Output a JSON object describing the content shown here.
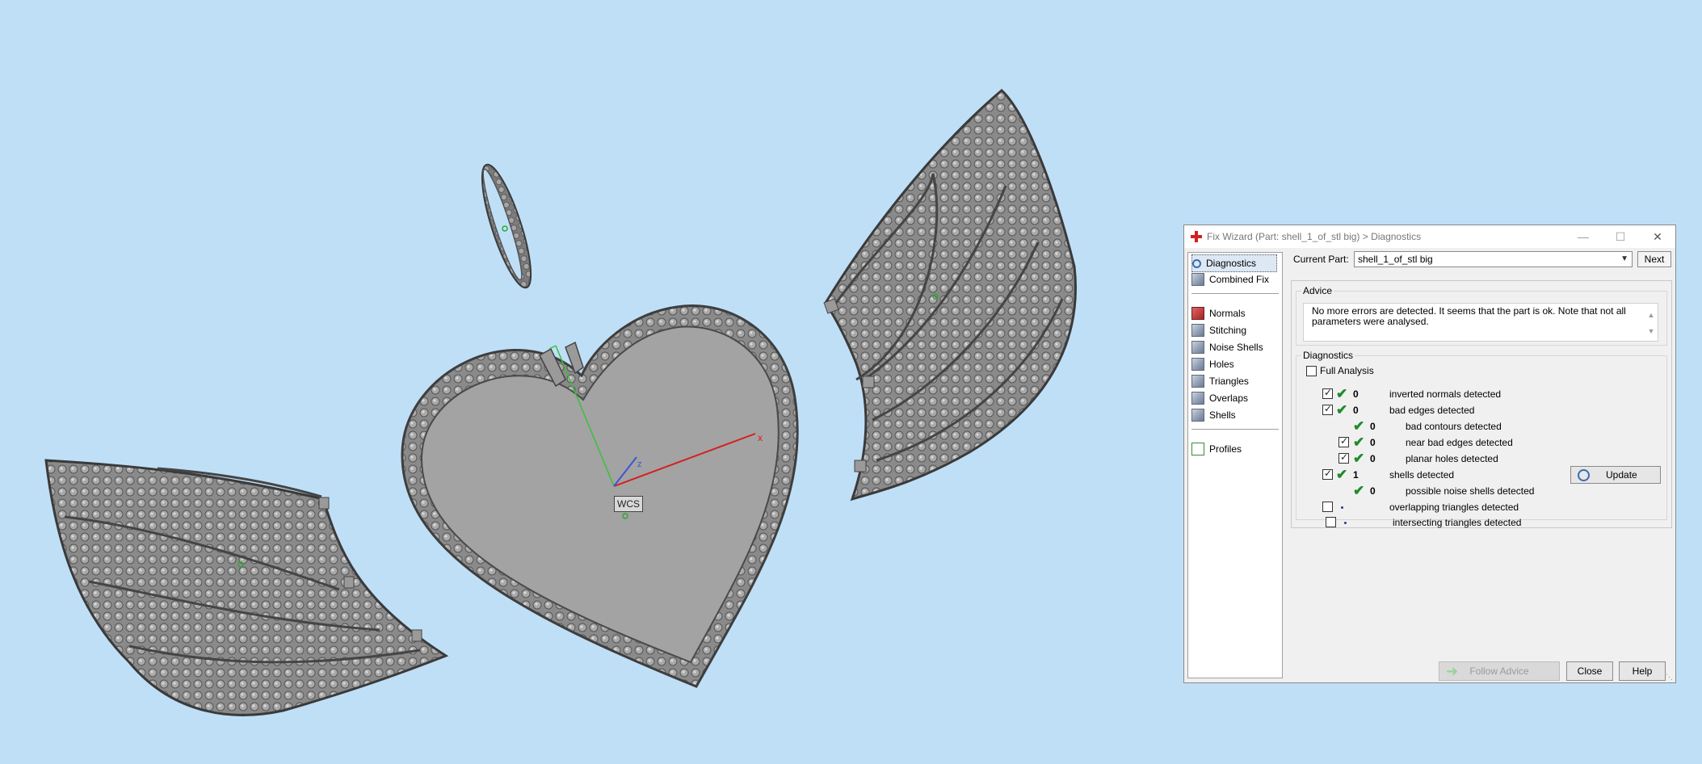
{
  "viewport": {
    "background": "#bfdff7",
    "wcs_label": "WCS",
    "axis_labels": {
      "x": "x",
      "z": "z"
    },
    "axis_colors": {
      "x": "#d42020",
      "y": "#3bbf3b",
      "z": "#3b55d4"
    }
  },
  "dialog": {
    "title": "Fix Wizard (Part: shell_1_of_stl big) > Diagnostics",
    "title_icon": "red-cross-icon",
    "window_buttons": {
      "minimize": "—",
      "maximize": "☐",
      "close": "✕"
    },
    "nav": {
      "items_top": [
        {
          "label": "Diagnostics",
          "icon": "magnifier-icon",
          "selected": true
        },
        {
          "label": "Combined Fix",
          "icon": "cube-icon"
        }
      ],
      "items_mid": [
        {
          "label": "Normals",
          "icon": "normals-icon"
        },
        {
          "label": "Stitching",
          "icon": "stitching-icon"
        },
        {
          "label": "Noise Shells",
          "icon": "noise-shells-icon"
        },
        {
          "label": "Holes",
          "icon": "holes-icon"
        },
        {
          "label": "Triangles",
          "icon": "triangles-icon"
        },
        {
          "label": "Overlaps",
          "icon": "overlaps-icon"
        },
        {
          "label": "Shells",
          "icon": "shells-icon"
        }
      ],
      "items_bottom": [
        {
          "label": "Profiles",
          "icon": "document-icon"
        }
      ]
    },
    "current_part_label": "Current Part:",
    "current_part_value": "shell_1_of_stl big",
    "next_label": "Next",
    "advice": {
      "title": "Advice",
      "text": "No more errors are detected. It seems that the part is ok. Note that not all parameters were analysed."
    },
    "diagnostics": {
      "title": "Diagnostics",
      "full_analysis_label": "Full Analysis",
      "full_analysis_checked": false,
      "rows": [
        {
          "checkbox": true,
          "checked": true,
          "status": "ok",
          "count": "0",
          "label": "inverted normals detected",
          "indent": 0
        },
        {
          "checkbox": true,
          "checked": true,
          "status": "ok",
          "count": "0",
          "label": "bad edges detected",
          "indent": 0
        },
        {
          "checkbox": false,
          "checked": false,
          "status": "ok",
          "count": "0",
          "label": "bad contours detected",
          "indent": 1
        },
        {
          "checkbox": true,
          "checked": true,
          "status": "ok",
          "count": "0",
          "label": "near bad edges detected",
          "indent": 1
        },
        {
          "checkbox": true,
          "checked": true,
          "status": "ok",
          "count": "0",
          "label": "planar holes detected",
          "indent": 1
        },
        {
          "checkbox": true,
          "checked": true,
          "status": "ok",
          "count": "1",
          "label": "shells detected",
          "indent": 0
        },
        {
          "checkbox": false,
          "checked": false,
          "status": "ok",
          "count": "0",
          "label": "possible noise shells detected",
          "indent": 1
        },
        {
          "checkbox": true,
          "checked": false,
          "status": "dot",
          "count": "",
          "label": "overlapping triangles detected",
          "indent": 0
        },
        {
          "checkbox": true,
          "checked": false,
          "status": "dot",
          "count": "",
          "label": "intersecting triangles detected",
          "indent": 0
        }
      ],
      "update_label": "Update"
    },
    "footer": {
      "follow_advice_label": "Follow Advice",
      "close_label": "Close",
      "help_label": "Help"
    }
  }
}
